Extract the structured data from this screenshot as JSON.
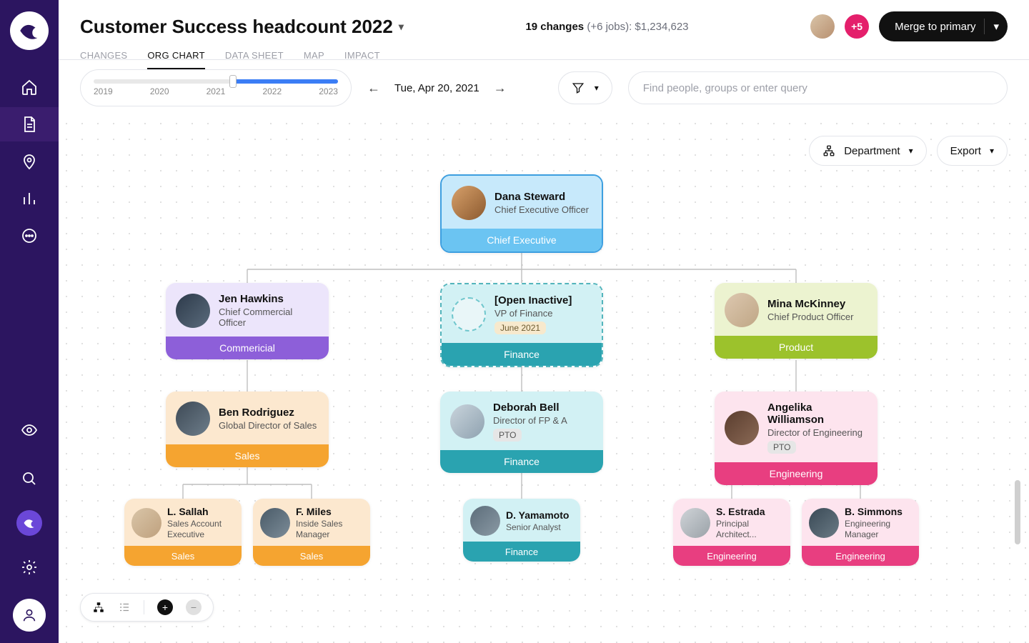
{
  "header": {
    "title": "Customer Success headcount 2022",
    "changes_bold": "19 changes",
    "changes_rest": " (+6 jobs): $1,234,623",
    "count_badge": "+5",
    "merge_button": "Merge to primary"
  },
  "tabs": [
    "CHANGES",
    "ORG CHART",
    "DATA SHEET",
    "MAP",
    "IMPACT"
  ],
  "active_tab": 1,
  "timeline": {
    "labels": [
      "2019",
      "2020",
      "2021",
      "2022",
      "2023"
    ]
  },
  "date_nav": {
    "date": "Tue, Apr 20, 2021"
  },
  "search": {
    "placeholder": "Find people, groups or enter query"
  },
  "canvas_controls": {
    "group_by": "Department",
    "export": "Export"
  },
  "cards": {
    "ceo": {
      "name": "Dana Steward",
      "role": "Chief Executive Officer",
      "footer": "Chief Executive"
    },
    "l1": [
      {
        "name": "Jen Hawkins",
        "role": "Chief Commercial Officer",
        "footer": "Commericial",
        "dept": "commercial"
      },
      {
        "name": "[Open Inactive]",
        "role": "VP of Finance",
        "footer": "Finance",
        "tag": "June 2021",
        "dept": "finance",
        "open": true
      },
      {
        "name": "Mina McKinney",
        "role": "Chief Product Officer",
        "footer": "Product",
        "dept": "product"
      }
    ],
    "l2": [
      {
        "name": "Ben Rodriguez",
        "role": "Global Director of Sales",
        "footer": "Sales",
        "dept": "sales"
      },
      {
        "name": "Deborah Bell",
        "role": "Director of FP & A",
        "footer": "Finance",
        "tag": "PTO",
        "dept": "finance"
      },
      {
        "name": "Angelika Williamson",
        "role": "Director of Engineering",
        "footer": "Engineering",
        "tag": "PTO",
        "dept": "eng"
      }
    ],
    "l3": [
      {
        "name": "L. Sallah",
        "role": "Sales Account Executive",
        "footer": "Sales",
        "dept": "sales"
      },
      {
        "name": "F. Miles",
        "role": "Inside Sales Manager",
        "footer": "Sales",
        "dept": "sales"
      },
      {
        "name": "D. Yamamoto",
        "role": "Senior Analyst",
        "footer": "Finance",
        "dept": "finance"
      },
      {
        "name": "S. Estrada",
        "role": "Principal Architect...",
        "footer": "Engineering",
        "dept": "eng"
      },
      {
        "name": "B. Simmons",
        "role": "Engineering Manager",
        "footer": "Engineering",
        "dept": "eng"
      }
    ]
  },
  "avatar_colors": {
    "ceo": "linear-gradient(135deg,#d7a06a,#8c5a2f)",
    "jen": "linear-gradient(135deg,#2d3a4a,#5a6b7c)",
    "mina": "linear-gradient(135deg,#ddc8b0,#bfa685)",
    "ben": "linear-gradient(135deg,#3e4a56,#6d7d8a)",
    "deborah": "linear-gradient(135deg,#c9d4dc,#8fa2b0)",
    "angelika": "linear-gradient(135deg,#5a3d2e,#8b6a56)",
    "sallah": "linear-gradient(135deg,#d9c5a8,#bfa17e)",
    "miles": "linear-gradient(135deg,#4a5b68,#7c8c98)",
    "yamamoto": "linear-gradient(135deg,#5c6d7a,#8a99a4)",
    "estrada": "linear-gradient(135deg,#d0d4d8,#9aa2a8)",
    "simmons": "linear-gradient(135deg,#3a4a56,#6a7a85)"
  }
}
